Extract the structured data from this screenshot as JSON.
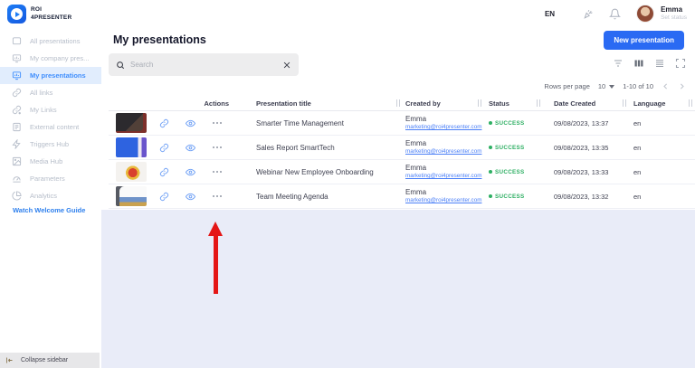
{
  "brand": {
    "line1": "ROI",
    "line2": "4PRESENTER"
  },
  "topbar": {
    "language": "EN",
    "user_name": "Emma",
    "user_status": "Set status"
  },
  "sidebar": {
    "items": [
      {
        "label": "All presentations",
        "icon": "presentation-screen-icon"
      },
      {
        "label": "My company pres...",
        "icon": "company-presentations-icon"
      },
      {
        "label": "My presentations",
        "icon": "my-presentations-icon",
        "active": true
      },
      {
        "label": "All links",
        "icon": "link-icon"
      },
      {
        "label": "My Links",
        "icon": "my-links-icon"
      },
      {
        "label": "External content",
        "icon": "external-content-icon"
      },
      {
        "label": "Triggers Hub",
        "icon": "lightning-icon"
      },
      {
        "label": "Media Hub",
        "icon": "media-image-icon"
      },
      {
        "label": "Parameters",
        "icon": "gauge-icon"
      },
      {
        "label": "Analytics",
        "icon": "pie-chart-icon"
      }
    ],
    "welcome_guide_label": "Watch Welcome Guide",
    "collapse_label": "Collapse sidebar"
  },
  "page": {
    "title": "My presentations",
    "new_presentation_button": "New presentation"
  },
  "search": {
    "placeholder": "Search"
  },
  "toolbar_icons": [
    "filter-icon",
    "grid-view-icon",
    "list-view-icon",
    "fullscreen-icon"
  ],
  "pagination": {
    "label": "Rows per page",
    "value": "10",
    "range": "1-10 of 10"
  },
  "table": {
    "columns": {
      "actions": "Actions",
      "title": "Presentation title",
      "created_by": "Created by",
      "status": "Status",
      "date_created": "Date Created",
      "language": "Language"
    },
    "row_action_icons": [
      "copy-link-icon",
      "preview-eye-icon",
      "more-actions-dots"
    ],
    "rows": [
      {
        "title": "Smarter Time Management",
        "author": "Emma",
        "email": "marketing@roi4presenter.com",
        "status": "SUCCESS",
        "date": "09/08/2023, 13:37",
        "language": "en"
      },
      {
        "title": "Sales Report SmartTech",
        "author": "Emma",
        "email": "marketing@roi4presenter.com",
        "status": "SUCCESS",
        "date": "09/08/2023, 13:35",
        "language": "en"
      },
      {
        "title": "Webinar New Employee Onboarding",
        "author": "Emma",
        "email": "marketing@roi4presenter.com",
        "status": "SUCCESS",
        "date": "09/08/2023, 13:33",
        "language": "en"
      },
      {
        "title": "Team Meeting Agenda",
        "author": "Emma",
        "email": "marketing@roi4presenter.com",
        "status": "SUCCESS",
        "date": "09/08/2023, 13:32",
        "language": "en"
      }
    ]
  },
  "annotation": {
    "type": "red-arrow",
    "points_at": "more-actions-dots of row 4 (Team Meeting Agenda)"
  },
  "colors": {
    "accent_blue": "#2a6af3",
    "active_item_bg": "#e1edfd",
    "success_green": "#2eaf63",
    "annotation_red": "#e41616",
    "bottom_background": "#e9ecf8"
  }
}
